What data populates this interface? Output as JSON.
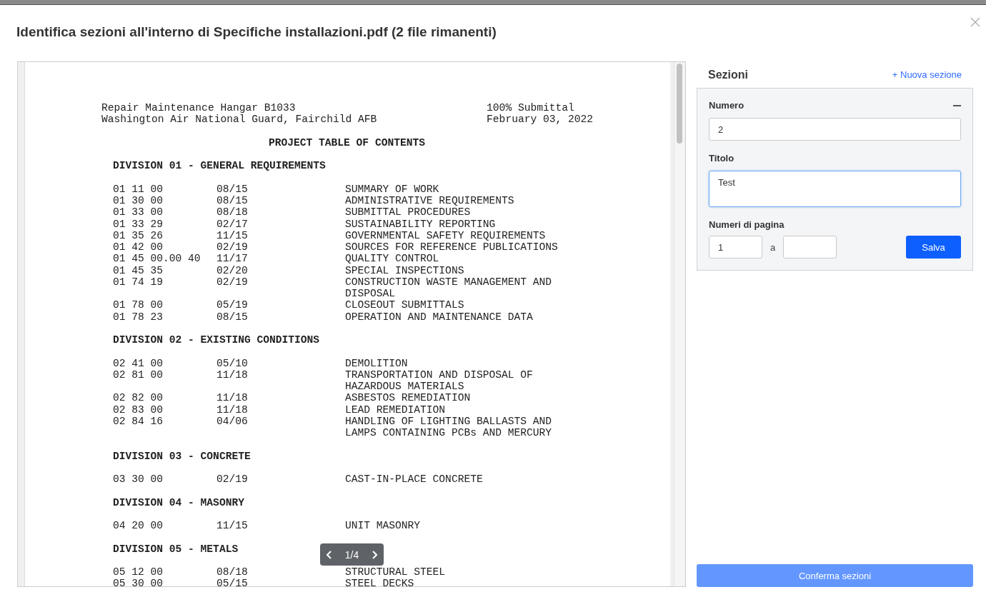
{
  "dialog": {
    "title": "Identifica sezioni all'interno di Specifiche installazioni.pdf (2 file rimanenti)"
  },
  "document": {
    "header_left": [
      "Repair Maintenance Hangar B1033",
      "Washington Air National Guard, Fairchild AFB"
    ],
    "header_right": [
      "100% Submittal",
      "February 03, 2022"
    ],
    "heading": "PROJECT TABLE OF CONTENTS",
    "divisions": [
      {
        "title": "DIVISION 01 - GENERAL REQUIREMENTS",
        "rows": [
          {
            "code": "01 11 00",
            "date": "08/15",
            "title": "SUMMARY OF WORK"
          },
          {
            "code": "01 30 00",
            "date": "08/15",
            "title": "ADMINISTRATIVE REQUIREMENTS"
          },
          {
            "code": "01 33 00",
            "date": "08/18",
            "title": "SUBMITTAL PROCEDURES"
          },
          {
            "code": "01 33 29",
            "date": "02/17",
            "title": "SUSTAINABILITY REPORTING"
          },
          {
            "code": "01 35 26",
            "date": "11/15",
            "title": "GOVERNMENTAL SAFETY REQUIREMENTS"
          },
          {
            "code": "01 42 00",
            "date": "02/19",
            "title": "SOURCES FOR REFERENCE PUBLICATIONS"
          },
          {
            "code": "01 45 00.00 40",
            "date": "11/17",
            "title": "QUALITY CONTROL"
          },
          {
            "code": "01 45 35",
            "date": "02/20",
            "title": "SPECIAL INSPECTIONS"
          },
          {
            "code": "01 74 19",
            "date": "02/19",
            "title": "CONSTRUCTION WASTE MANAGEMENT AND DISPOSAL"
          },
          {
            "code": "01 78 00",
            "date": "05/19",
            "title": "CLOSEOUT SUBMITTALS"
          },
          {
            "code": "01 78 23",
            "date": "08/15",
            "title": "OPERATION AND MAINTENANCE DATA"
          }
        ]
      },
      {
        "title": "DIVISION 02 - EXISTING CONDITIONS",
        "rows": [
          {
            "code": "02 41 00",
            "date": "05/10",
            "title": "DEMOLITION"
          },
          {
            "code": "02 81 00",
            "date": "11/18",
            "title": "TRANSPORTATION AND DISPOSAL OF HAZARDOUS MATERIALS"
          },
          {
            "code": "02 82 00",
            "date": "11/18",
            "title": "ASBESTOS REMEDIATION"
          },
          {
            "code": "02 83 00",
            "date": "11/18",
            "title": "LEAD REMEDIATION"
          },
          {
            "code": "02 84 16",
            "date": "04/06",
            "title": "HANDLING OF LIGHTING BALLASTS AND LAMPS CONTAINING PCBs AND MERCURY"
          }
        ]
      },
      {
        "title": "DIVISION 03 - CONCRETE",
        "rows": [
          {
            "code": "03 30 00",
            "date": "02/19",
            "title": "CAST-IN-PLACE CONCRETE"
          }
        ]
      },
      {
        "title": "DIVISION 04 - MASONRY",
        "rows": [
          {
            "code": "04 20 00",
            "date": "11/15",
            "title": "UNIT MASONRY"
          }
        ]
      },
      {
        "title": "DIVISION 05 - METALS",
        "rows": [
          {
            "code": "05 12 00",
            "date": "08/18",
            "title": "STRUCTURAL STEEL"
          },
          {
            "code": "05 30 00",
            "date": "05/15",
            "title": "STEEL DECKS"
          }
        ]
      }
    ]
  },
  "pager": {
    "page": "1/4"
  },
  "sections": {
    "title": "Sezioni",
    "new_link": "+ Nuova sezione",
    "card": {
      "number_label": "Numero",
      "number_value": "2",
      "title_label": "Titolo",
      "title_value": "Test",
      "title_focused": true,
      "pages_label": "Numeri di pagina",
      "page_from": "1",
      "separator": "a",
      "save": "Salva"
    },
    "confirm": {
      "label": "Conferma sezioni",
      "disabled": true
    }
  }
}
